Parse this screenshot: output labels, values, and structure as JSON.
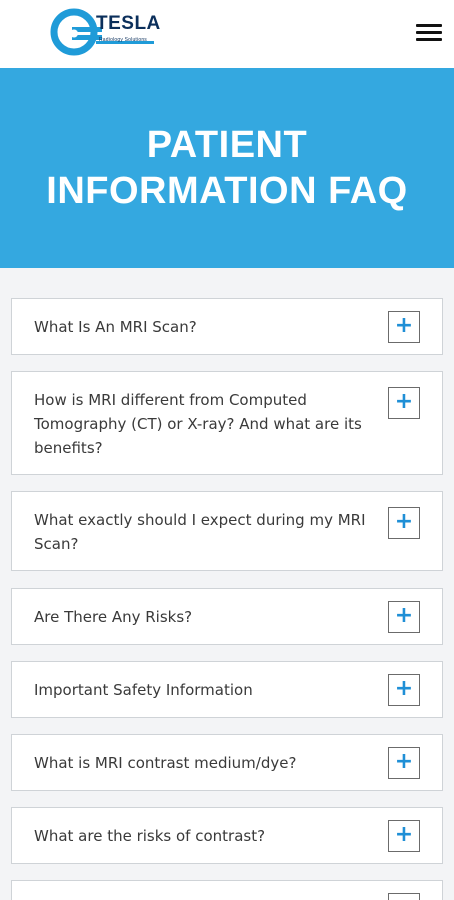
{
  "header": {
    "logo_name": "TESLA",
    "logo_tagline": "Radiology Solutions",
    "menu_icon": "hamburger-menu-icon"
  },
  "hero": {
    "title_line1": "PATIENT",
    "title_line2": "INFORMATION FAQ"
  },
  "colors": {
    "hero_bg": "#34a8e0",
    "accent": "#1f8fd6",
    "logo_dark": "#0b2f5b"
  },
  "faqs": [
    {
      "question": "What Is An MRI Scan?"
    },
    {
      "question": "How is MRI different from Computed Tomography (CT) or X-ray? And what are its benefits?"
    },
    {
      "question": "What exactly should I expect during my MRI Scan?"
    },
    {
      "question": "Are There Any Risks?"
    },
    {
      "question": "Important Safety Information"
    },
    {
      "question": "What is MRI contrast medium/dye?"
    },
    {
      "question": "What are the risks of contrast?"
    },
    {
      "question": ""
    }
  ],
  "expand_symbol": "+"
}
